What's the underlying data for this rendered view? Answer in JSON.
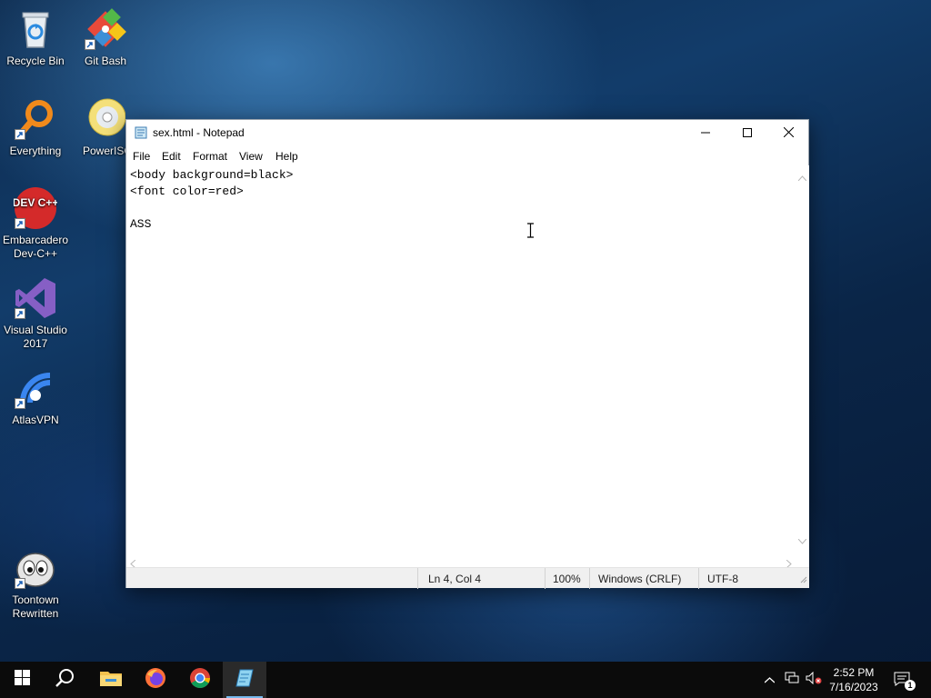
{
  "desktop": {
    "icons": [
      {
        "label_line1": "Recycle Bin",
        "label_line2": "",
        "icon": "recycle-bin-icon"
      },
      {
        "label_line1": "Git Bash",
        "label_line2": "",
        "icon": "git-bash-icon"
      },
      {
        "label_line1": "Everything",
        "label_line2": "",
        "icon": "everything-search-icon"
      },
      {
        "label_line1": "PowerISO",
        "label_line2": "",
        "icon": "poweriso-disc-icon"
      },
      {
        "label_line1": "Embarcadero",
        "label_line2": "Dev-C++",
        "icon": "devcpp-icon",
        "glyph_text": "DEV C++"
      },
      {
        "label_line1": "Visual Studio",
        "label_line2": "2017",
        "icon": "visual-studio-icon"
      },
      {
        "label_line1": "AtlasVPN",
        "label_line2": "",
        "icon": "atlasvpn-icon"
      },
      {
        "label_line1": "Toontown",
        "label_line2": "Rewritten",
        "icon": "toontown-icon"
      }
    ]
  },
  "notepad": {
    "title": "sex.html - Notepad",
    "menu": [
      "File",
      "Edit",
      "Format",
      "View",
      "Help"
    ],
    "content": "<body background=black>\n<font color=red>\n\nASS",
    "status": {
      "position": "Ln 4, Col 4",
      "zoom": "100%",
      "line_ending": "Windows (CRLF)",
      "encoding": "UTF-8"
    }
  },
  "taskbar": {
    "apps": [
      "start-icon",
      "search-icon",
      "file-explorer-icon",
      "firefox-icon",
      "chrome-icon",
      "notepad-icon"
    ],
    "active_app": "notepad-icon",
    "clock": {
      "time": "2:52 PM",
      "date": "7/16/2023"
    },
    "notification_count": "1"
  },
  "colors": {
    "taskbar": "#0b0b0b",
    "accent": "#76b9ed",
    "desktop": "#0d2a4d"
  }
}
